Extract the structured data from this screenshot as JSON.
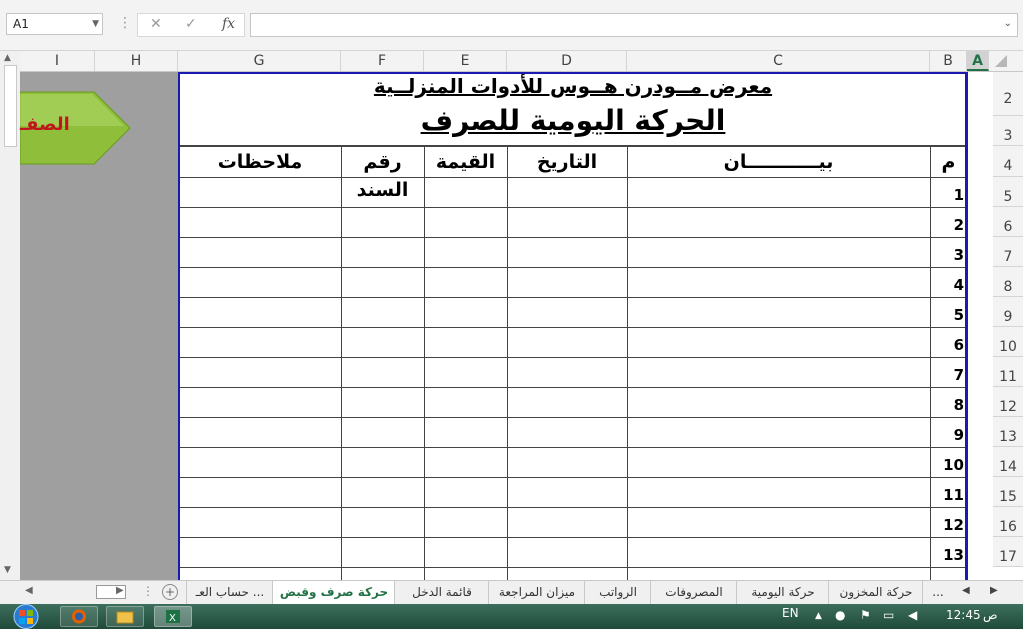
{
  "formula_bar": {
    "name_box": "A1",
    "cancel": "✕",
    "enter": "✓",
    "fx": "fx",
    "value": ""
  },
  "columns": [
    "I",
    "H",
    "G",
    "F",
    "E",
    "D",
    "C",
    "B",
    "A"
  ],
  "rows": [
    "2",
    "3",
    "4",
    "5",
    "6",
    "7",
    "8",
    "9",
    "10",
    "11",
    "12",
    "13",
    "14",
    "15",
    "16",
    "17"
  ],
  "sheet": {
    "title": "معرض مــودرن هــوس للأدوات المنزلــية",
    "subtitle": "الحركة اليومية للصرف",
    "headers": {
      "notes": "ملاحظات",
      "doc_no": "رقم السند",
      "value": "القيمة",
      "date": "التاريخ",
      "statement": "بيـــــــــــان",
      "index": "م"
    },
    "row_numbers": [
      "1",
      "2",
      "3",
      "4",
      "5",
      "6",
      "7",
      "8",
      "9",
      "10",
      "11",
      "12",
      "13"
    ],
    "side_button": "الصفـ"
  },
  "tabs": [
    "حساب العـ ...",
    "حركة صرف وقبض",
    "قائمة الدخل",
    "ميزان المراجعة",
    "الرواتب",
    "المصروفات",
    "حركة اليومية",
    "حركة المخزون",
    "..."
  ],
  "taskbar": {
    "lang": "EN",
    "time": "12:45",
    "ampm": "ص"
  },
  "colors": {
    "accent": "#217346",
    "frame": "#1a1ab0",
    "grey_fill": "#9f9f9f",
    "button_green": "#8fbf3a"
  }
}
